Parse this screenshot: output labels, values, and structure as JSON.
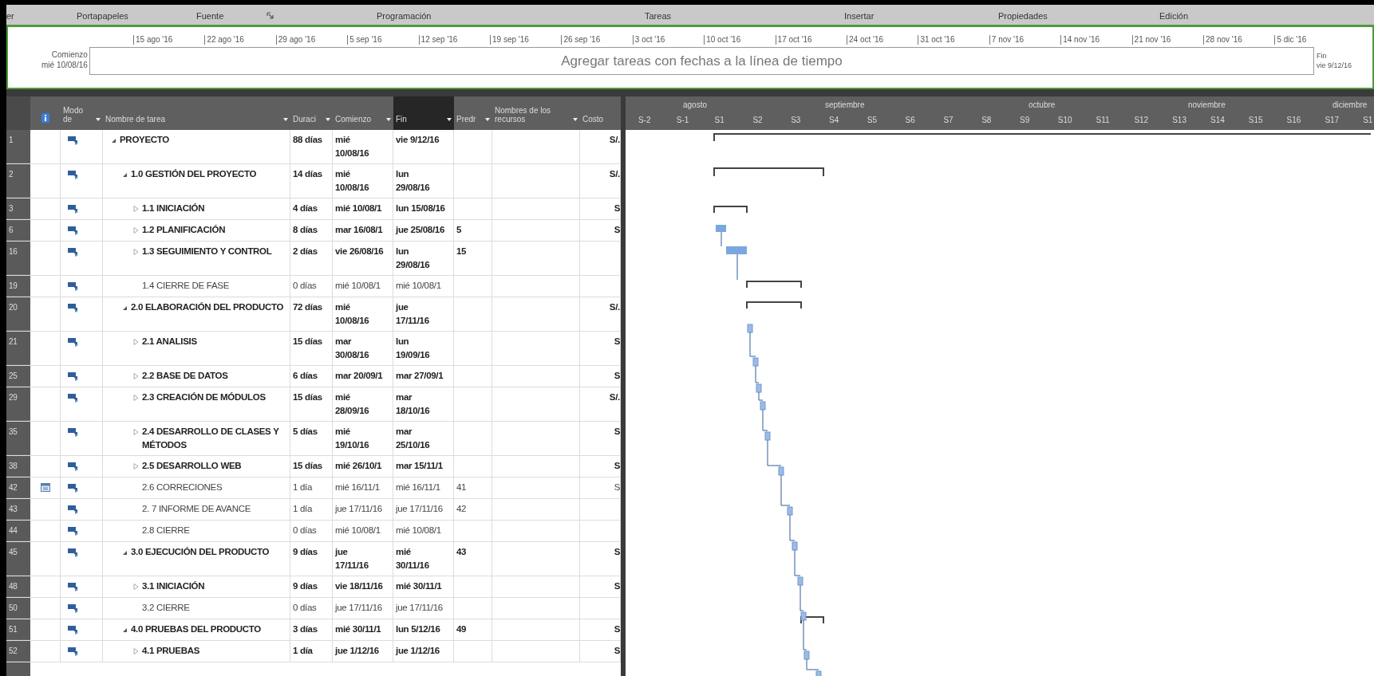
{
  "ribbon_groups": [
    {
      "label": "er",
      "launcher": false
    },
    {
      "label": "Portapapeles",
      "launcher": false
    },
    {
      "label": "Fuente",
      "launcher": true
    },
    {
      "label": "Programación",
      "launcher": false
    },
    {
      "label": "Tareas",
      "launcher": false
    },
    {
      "label": "Insertar",
      "launcher": false
    },
    {
      "label": "Propiedades",
      "launcher": false
    },
    {
      "label": "Edición",
      "launcher": false
    }
  ],
  "timeline": {
    "start_label": "Comienzo",
    "start_date": "mié 10/08/16",
    "ticks": [
      "15 ago '16",
      "22 ago '16",
      "29 ago '16",
      "5 sep '16",
      "12 sep '16",
      "19 sep '16",
      "26 sep '16",
      "3 oct '16",
      "10 oct '16",
      "17 oct '16",
      "24 oct '16",
      "31 oct '16",
      "7 nov '16",
      "14 nov '16",
      "21 nov '16",
      "28 nov '16",
      "5 dic '16"
    ],
    "prompt": "Agregar tareas con fechas a la línea de tiempo",
    "end_label": "Fin",
    "end_date": "vie 9/12/16"
  },
  "table": {
    "columns": [
      {
        "kind": "info",
        "selected": false,
        "dropdown": false
      },
      {
        "label": "Modo\nde",
        "selected": false,
        "dropdown": true
      },
      {
        "label": "Nombre de tarea",
        "selected": false,
        "dropdown": true
      },
      {
        "label": "Duraci",
        "selected": false,
        "dropdown": true
      },
      {
        "label": "Comienzo",
        "selected": false,
        "dropdown": true
      },
      {
        "label": "Fin",
        "selected": true,
        "dropdown": true
      },
      {
        "label": "Predr",
        "selected": false,
        "dropdown": true
      },
      {
        "label": "Nombres de los\nrecursos",
        "selected": false,
        "dropdown": true
      },
      {
        "label": "Costo",
        "selected": false,
        "dropdown": false
      }
    ],
    "rows": [
      {
        "id": "1",
        "kind": "summary",
        "expanded": true,
        "name": "PROYECTO",
        "duration": "88 días",
        "start": "mié\n10/08/16",
        "finish": "vie 9/12/16",
        "cost": "S/.",
        "children": [
          {
            "id": "2",
            "kind": "summary",
            "expanded": true,
            "name": "1.0 GESTIÓN DEL PROYECTO",
            "duration": "14 días",
            "start": "mié\n10/08/16",
            "finish": "lun\n29/08/16",
            "cost": "S/.",
            "children": [
              {
                "id": "3",
                "kind": "summary",
                "expanded": false,
                "name": "1.1 INICIACIÓN",
                "duration": "4 días",
                "start": "mié 10/08/1",
                "finish": "lun 15/08/16",
                "cost": "S"
              },
              {
                "id": "6",
                "kind": "summary",
                "expanded": false,
                "name": "1.2 PLANIFICACIÓN",
                "duration": "8 días",
                "start": "mar 16/08/1",
                "finish": "jue 25/08/16",
                "predecessors": "5",
                "cost": "S"
              },
              {
                "id": "16",
                "kind": "summary",
                "expanded": false,
                "name": "1.3 SEGUIMIENTO Y CONTROL",
                "duration": "2 días",
                "start": "vie 26/08/16",
                "finish": "lun\n29/08/16",
                "predecessors": "15"
              },
              {
                "id": "19",
                "kind": "task",
                "name": "1.4 CIERRE DE FASE",
                "duration": "0 días",
                "start": "mié 10/08/1",
                "finish": "mié 10/08/1"
              }
            ]
          },
          {
            "id": "20",
            "kind": "summary",
            "expanded": true,
            "name": "2.0 ELABORACIÓN DEL PRODUCTO",
            "duration": "72 días",
            "start": "mié\n10/08/16",
            "finish": "jue\n17/11/16",
            "cost": "S/.",
            "children": [
              {
                "id": "21",
                "kind": "summary",
                "expanded": false,
                "name": "2.1 ANALISIS",
                "duration": "15 días",
                "start": "mar\n30/08/16",
                "finish": "lun\n19/09/16",
                "cost": "S"
              },
              {
                "id": "25",
                "kind": "summary",
                "expanded": false,
                "name": "2.2 BASE DE DATOS",
                "duration": "6 días",
                "start": "mar 20/09/1",
                "finish": "mar 27/09/1",
                "cost": "S"
              },
              {
                "id": "29",
                "kind": "summary",
                "expanded": false,
                "name": "2.3 CREACIÓN DE MÓDULOS",
                "duration": "15 días",
                "start": "mié\n28/09/16",
                "finish": "mar\n18/10/16",
                "cost": "S/."
              },
              {
                "id": "35",
                "kind": "summary",
                "expanded": false,
                "name": "2.4 DESARROLLO DE CLASES Y\nMÉTODOS",
                "duration": "5 días",
                "start": "mié\n19/10/16",
                "finish": "mar\n25/10/16",
                "cost": "S"
              },
              {
                "id": "38",
                "kind": "summary",
                "expanded": false,
                "name": "2.5 DESARROLLO WEB",
                "duration": "15 días",
                "start": "mié 26/10/1",
                "finish": "mar 15/11/1",
                "cost": "S"
              },
              {
                "id": "42",
                "kind": "task",
                "indicator": true,
                "name": "2.6 CORRECIONES",
                "duration": "1 día",
                "start": "mié 16/11/1",
                "finish": "mié 16/11/1",
                "predecessors": "41",
                "cost": "S"
              },
              {
                "id": "43",
                "kind": "task",
                "name": "2. 7 INFORME DE AVANCE",
                "duration": "1 día",
                "start": "jue 17/11/16",
                "finish": "jue 17/11/16",
                "predecessors": "42"
              },
              {
                "id": "44",
                "kind": "task",
                "name": "2.8 CIERRE",
                "duration": "0 días",
                "start": "mié 10/08/1",
                "finish": "mié 10/08/1"
              }
            ]
          },
          {
            "id": "45",
            "kind": "summary",
            "expanded": true,
            "name": "3.0 EJECUCIÓN DEL PRODUCTO",
            "duration": "9 días",
            "start": "jue\n17/11/16",
            "finish": "mié\n30/11/16",
            "predecessors": "43",
            "cost": "S",
            "children": [
              {
                "id": "48",
                "kind": "summary",
                "expanded": false,
                "name": "3.1 INICIACIÓN",
                "duration": "9 días",
                "start": "vie 18/11/16",
                "finish": "mié 30/11/1",
                "cost": "S"
              },
              {
                "id": "50",
                "kind": "task",
                "name": "3.2 CIERRE",
                "duration": "0 días",
                "start": "jue 17/11/16",
                "finish": "jue 17/11/16"
              }
            ]
          },
          {
            "id": "51",
            "kind": "summary",
            "expanded": true,
            "name": "4.0 PRUEBAS DEL PRODUCTO",
            "duration": "3 días",
            "start": "mié 30/11/1",
            "finish": "lun 5/12/16",
            "predecessors": "49",
            "cost": "S",
            "children": [
              {
                "id": "52",
                "kind": "summary",
                "expanded": false,
                "name": "4.1 PRUEBAS",
                "duration": "1 día",
                "start": "jue 1/12/16",
                "finish": "jue 1/12/16",
                "cost": "S"
              }
            ]
          }
        ]
      }
    ]
  },
  "gantt": {
    "months": [
      "agosto",
      "septiembre",
      "octubre",
      "noviembre",
      "diciembre"
    ],
    "weeks": [
      "S-2",
      "S-1",
      "S1",
      "S2",
      "S3",
      "S4",
      "S5",
      "S6",
      "S7",
      "S8",
      "S9",
      "S10",
      "S11",
      "S12",
      "S13",
      "S14",
      "S15",
      "S16",
      "S17",
      "S1"
    ]
  }
}
